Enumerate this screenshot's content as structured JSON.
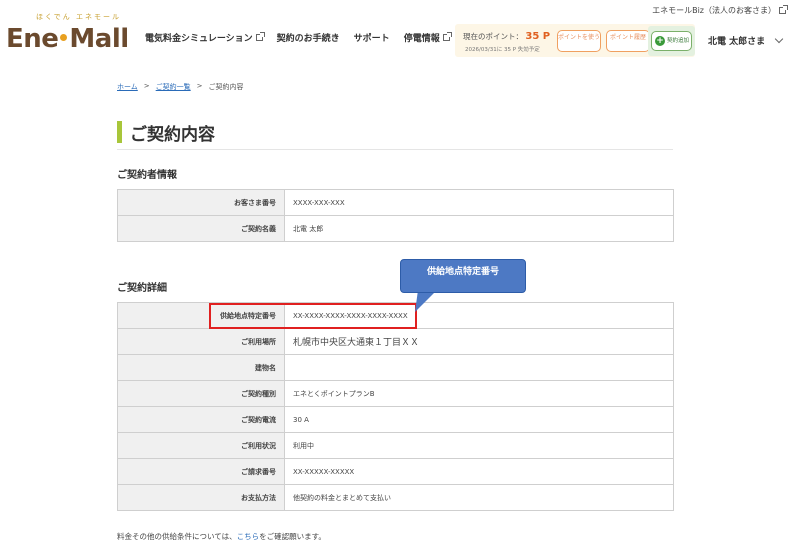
{
  "header": {
    "biz_link": "エネモールBiz（法人のお客さま）",
    "logo_kana": "ほくでん エネモール",
    "logo_part1": "Ene",
    "logo_part2": "Mall",
    "nav": [
      {
        "label": "電気料金シミュレーション",
        "external": true
      },
      {
        "label": "契約のお手続き",
        "external": false
      },
      {
        "label": "サポート",
        "external": false
      },
      {
        "label": "停電情報",
        "external": true
      }
    ],
    "points": {
      "label": "現在のポイント：",
      "value": "35 P",
      "expire": "2026/03/31に 35 P 失効予定",
      "use_label": "ポイントを使う",
      "history_label": "ポイント履歴"
    },
    "contract_add_label": "契約追加",
    "user_name": "北電 太郎さま"
  },
  "breadcrumb": {
    "home": "ホーム",
    "list": "ご契約一覧",
    "current": "ご契約内容",
    "sep": ">"
  },
  "page_title": "ご契約内容",
  "section1": {
    "title": "ご契約者情報",
    "rows": [
      {
        "label": "お客さま番号",
        "value": "XXXX-XXX-XXX"
      },
      {
        "label": "ご契約名義",
        "value": "北電 太郎"
      }
    ]
  },
  "section2": {
    "title": "ご契約詳細",
    "rows": [
      {
        "label": "供給地点特定番号",
        "value": "XX-XXXX-XXXX-XXXX-XXXX-XXXX"
      },
      {
        "label": "ご利用場所",
        "value": "札幌市中央区大通東１丁目ＸＸ"
      },
      {
        "label": "建物名",
        "value": ""
      },
      {
        "label": "ご契約種別",
        "value": "エネとくポイントプランB"
      },
      {
        "label": "ご契約電流",
        "value": "30 A"
      },
      {
        "label": "ご利用状況",
        "value": "利用中"
      },
      {
        "label": "ご請求番号",
        "value": "XX-XXXXX-XXXXX"
      },
      {
        "label": "お支払方法",
        "value": "他契約の料金とまとめて支払い"
      }
    ]
  },
  "callout": "供給地点特定番号",
  "footer": {
    "prefix": "料金その他の供給条件については、",
    "link": "こちら",
    "suffix": "をご確認願います。"
  },
  "colors": {
    "accent_green": "#a8c63a",
    "link_blue": "#2a6bb8",
    "callout_blue": "#4d79c4",
    "highlight_red": "#e02020",
    "points_orange": "#e06020"
  }
}
